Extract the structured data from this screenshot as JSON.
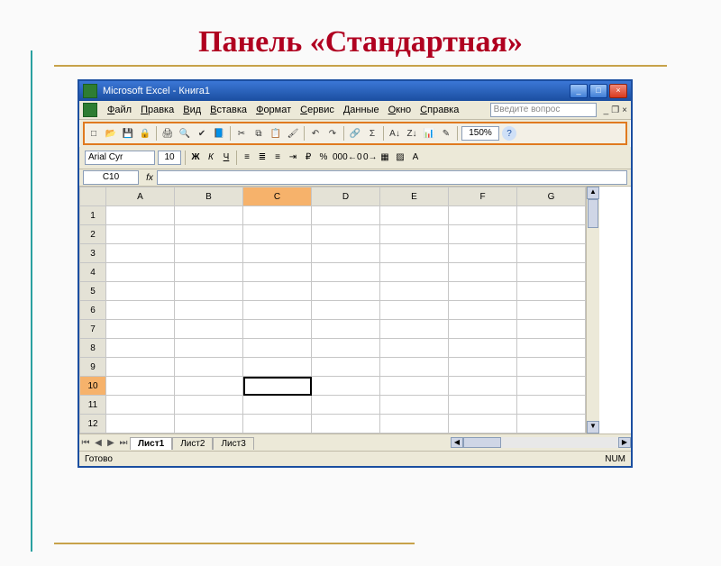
{
  "slide": {
    "title": "Панель «Стандартная»"
  },
  "window": {
    "title": "Microsoft Excel - Книга1"
  },
  "menu": {
    "items": [
      "Файл",
      "Правка",
      "Вид",
      "Вставка",
      "Формат",
      "Сервис",
      "Данные",
      "Окно",
      "Справка"
    ],
    "help_placeholder": "Введите вопрос"
  },
  "standard_toolbar": {
    "buttons": [
      "new",
      "open",
      "save",
      "permission",
      "print",
      "print-preview",
      "spelling",
      "research",
      "cut",
      "copy",
      "paste",
      "format-painter",
      "undo",
      "redo",
      "hyperlink",
      "autosum",
      "sort-asc",
      "sort-desc",
      "chart-wizard",
      "drawing"
    ],
    "zoom": "150%"
  },
  "format_toolbar": {
    "font_name": "Arial Cyr",
    "font_size": "10",
    "buttons": [
      "Ж",
      "К",
      "Ч"
    ],
    "extras": [
      "align-left",
      "align-center",
      "align-right",
      "merge",
      "currency",
      "percent",
      "comma",
      "inc-dec",
      "dec-dec",
      "borders",
      "fill",
      "font-color"
    ]
  },
  "namebox": "C10",
  "grid": {
    "columns": [
      "A",
      "B",
      "C",
      "D",
      "E",
      "F",
      "G"
    ],
    "rows": [
      "1",
      "2",
      "3",
      "4",
      "5",
      "6",
      "7",
      "8",
      "9",
      "10",
      "11",
      "12"
    ],
    "active_cell": "C10",
    "selected_col": "C",
    "selected_row": "10"
  },
  "tabs": {
    "sheets": [
      "Лист1",
      "Лист2",
      "Лист3"
    ],
    "active": "Лист1"
  },
  "status": {
    "left": "Готово",
    "indicator": "NUM"
  }
}
